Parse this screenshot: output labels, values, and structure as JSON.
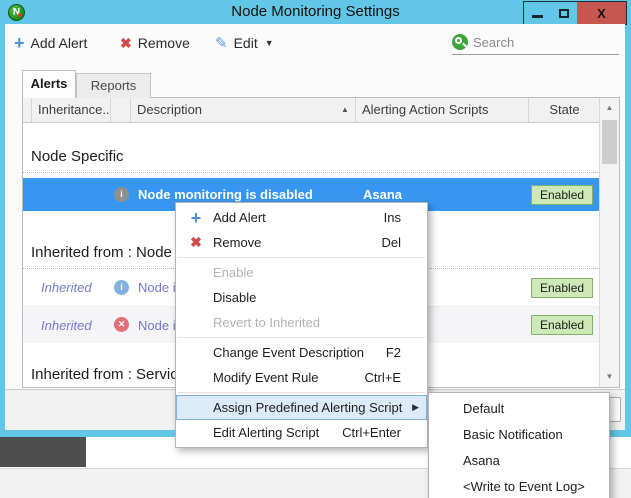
{
  "window": {
    "title": "Node Monitoring Settings",
    "controls": {
      "minimize_glyph": "–",
      "maximize_glyph": "□",
      "close_glyph": "X"
    }
  },
  "toolbar": {
    "add_alert_label": "Add Alert",
    "remove_label": "Remove",
    "edit_label": "Edit",
    "search": {
      "placeholder": "Search"
    }
  },
  "tabs": {
    "alerts": "Alerts",
    "reports": "Reports"
  },
  "grid": {
    "columns": {
      "inheritance": "Inheritance...",
      "description": "Description",
      "scripts": "Alerting Action Scripts",
      "state": "State"
    },
    "sort_indicator": "▲",
    "groups": {
      "node_specific": "Node Specific",
      "inherited_node": "Inherited from : Node",
      "inherited_service": "Inherited from : Servic"
    },
    "rows": [
      {
        "inheritance": "",
        "description": "Node monitoring is disabled",
        "script": "Asana",
        "state": "Enabled"
      },
      {
        "inheritance": "Inherited",
        "description": "Node is",
        "script": "",
        "state": "Enabled"
      },
      {
        "inheritance": "Inherited",
        "description": "Node is",
        "script": "",
        "state": "Enabled"
      }
    ]
  },
  "context_menu": {
    "items": [
      {
        "label": "Add Alert",
        "shortcut": "Ins"
      },
      {
        "label": "Remove",
        "shortcut": "Del"
      },
      {
        "label": "Enable",
        "shortcut": ""
      },
      {
        "label": "Disable",
        "shortcut": ""
      },
      {
        "label": "Revert to Inherited",
        "shortcut": ""
      },
      {
        "label": "Change Event Description",
        "shortcut": "F2"
      },
      {
        "label": "Modify Event Rule",
        "shortcut": "Ctrl+E"
      },
      {
        "label": "Assign Predefined Alerting Script",
        "shortcut": ""
      },
      {
        "label": "Edit Alerting Script",
        "shortcut": "Ctrl+Enter"
      }
    ],
    "submenu_arrow": "▶"
  },
  "submenu": {
    "items": [
      {
        "label": "Default"
      },
      {
        "label": "Basic Notification"
      },
      {
        "label": "Asana"
      },
      {
        "label": "<Write to Event Log>"
      }
    ]
  },
  "colors": {
    "titlebar": "#62c7e7",
    "selection_blue": "#3797f0",
    "close_button_red": "#c5574f",
    "badge_green_bg": "#cde9b7",
    "badge_green_border": "#83b068",
    "inherited_text": "#7577cd",
    "accent_blue": "#4a8fd4",
    "accent_red": "#cf4a4a",
    "search_green": "#3aa63a",
    "menu_highlight": "#dcebfa"
  }
}
